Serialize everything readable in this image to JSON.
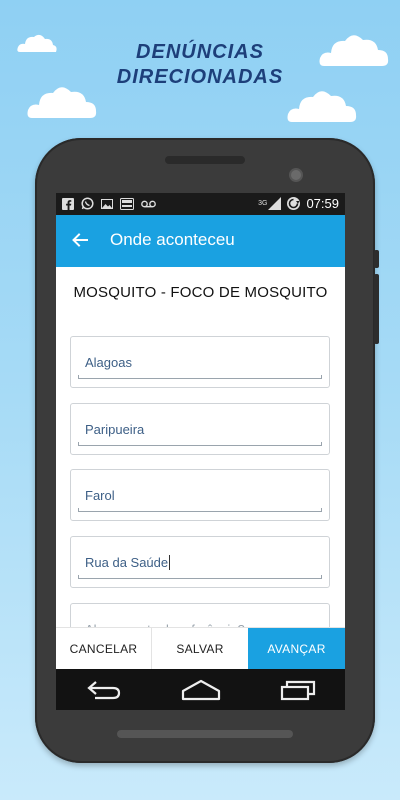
{
  "promo": {
    "headline_line1": "DENÚNCIAS",
    "headline_line2": "DIRECIONADAS"
  },
  "status_bar": {
    "time": "07:59",
    "network": "3G",
    "icons_left": [
      "facebook-icon",
      "whatsapp-icon",
      "image-icon",
      "badge-icon",
      "voicemail-icon"
    ],
    "icons_right": [
      "signal-icon",
      "sync-icon"
    ]
  },
  "app_bar": {
    "title": "Onde aconteceu",
    "back_icon": "arrow-left-icon"
  },
  "form": {
    "subject": "MOSQUITO - FOCO DE MOSQUITO",
    "fields": [
      {
        "value": "Alagoas"
      },
      {
        "value": "Paripueira"
      },
      {
        "value": "Farol"
      },
      {
        "value": "Rua da Saúde"
      },
      {
        "value": "",
        "placeholder": "Algum ponto de referência?"
      }
    ]
  },
  "actions": {
    "cancel_label": "CANCELAR",
    "save_label": "SALVAR",
    "next_label": "AVANÇAR"
  },
  "nav_bar": {
    "icons": [
      "back-icon",
      "home-icon",
      "recents-icon"
    ]
  },
  "colors": {
    "accent": "#1aa1e1",
    "headline": "#1d3f7a",
    "sky": "#a7dbf6",
    "phone_body": "#3b3b3b"
  }
}
